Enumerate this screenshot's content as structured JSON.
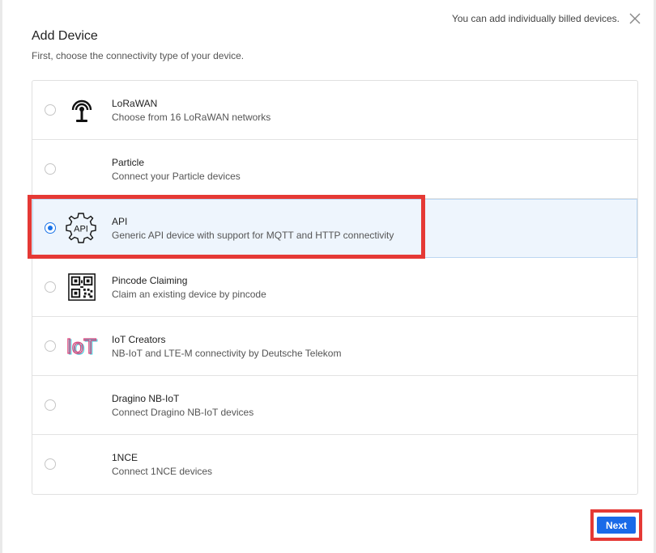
{
  "header": {
    "title": "Add Device",
    "subtitle": "First, choose the connectivity type of your device.",
    "notice": "You can add individually billed devices."
  },
  "options": [
    {
      "title": "LoRaWAN",
      "description": "Choose from 16 LoRaWAN networks",
      "icon": "antenna-icon",
      "selected": false
    },
    {
      "title": "Particle",
      "description": "Connect your Particle devices",
      "icon": "",
      "selected": false
    },
    {
      "title": "API",
      "description": "Generic API device with support for MQTT and HTTP connectivity",
      "icon": "api-gear-icon",
      "icon_text": "API",
      "selected": true
    },
    {
      "title": "Pincode Claiming",
      "description": "Claim an existing device by pincode",
      "icon": "qr-code-icon",
      "selected": false
    },
    {
      "title": "IoT Creators",
      "description": "NB-IoT and LTE-M connectivity by Deutsche Telekom",
      "icon": "iot-creators-logo",
      "icon_text": "IoT",
      "selected": false
    },
    {
      "title": "Dragino NB-IoT",
      "description": "Connect Dragino NB-IoT devices",
      "icon": "",
      "selected": false
    },
    {
      "title": "1NCE",
      "description": "Connect 1NCE devices",
      "icon": "",
      "selected": false
    }
  ],
  "footer": {
    "next_label": "Next"
  },
  "colors": {
    "accent": "#1a6ae8",
    "highlight_border": "#e53935",
    "selected_row_bg": "#eef5fd"
  }
}
